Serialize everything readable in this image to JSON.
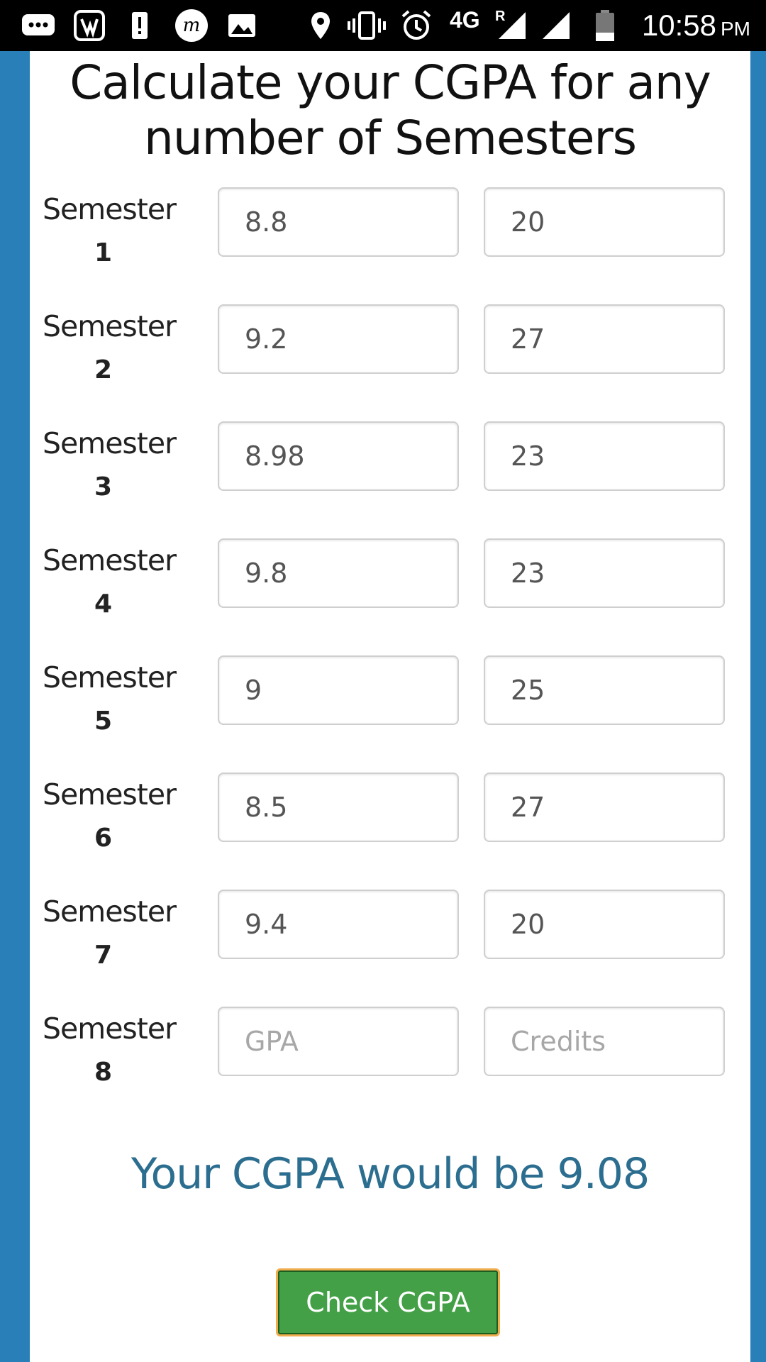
{
  "status_bar": {
    "time": "10:58",
    "ampm": "PM",
    "network": "4G",
    "roaming": "R",
    "icons": [
      "messages-icon",
      "jiosaavn-icon",
      "alert-icon",
      "m-app-icon",
      "gallery-icon",
      "location-icon",
      "vibrate-icon",
      "alarm-icon",
      "signal-icon",
      "signal-icon-2",
      "battery-icon"
    ]
  },
  "page": {
    "title": "Calculate your CGPA for any number of Semesters"
  },
  "semesters": [
    {
      "label": "Semester",
      "number": "1",
      "gpa": "8.8",
      "credits": "20"
    },
    {
      "label": "Semester",
      "number": "2",
      "gpa": "9.2",
      "credits": "27"
    },
    {
      "label": "Semester",
      "number": "3",
      "gpa": "8.98",
      "credits": "23"
    },
    {
      "label": "Semester",
      "number": "4",
      "gpa": "9.8",
      "credits": "23"
    },
    {
      "label": "Semester",
      "number": "5",
      "gpa": "9",
      "credits": "25"
    },
    {
      "label": "Semester",
      "number": "6",
      "gpa": "8.5",
      "credits": "27"
    },
    {
      "label": "Semester",
      "number": "7",
      "gpa": "9.4",
      "credits": "20"
    },
    {
      "label": "Semester",
      "number": "8",
      "gpa": "",
      "credits": ""
    }
  ],
  "placeholders": {
    "gpa": "GPA",
    "credits": "Credits"
  },
  "result_text": "Your CGPA would be 9.08",
  "check_button_label": "Check CGPA",
  "colors": {
    "side_background": "#2980b9",
    "result_text": "#2c6e8f",
    "button": "#43a047",
    "button_border": "#f0ad4e"
  }
}
